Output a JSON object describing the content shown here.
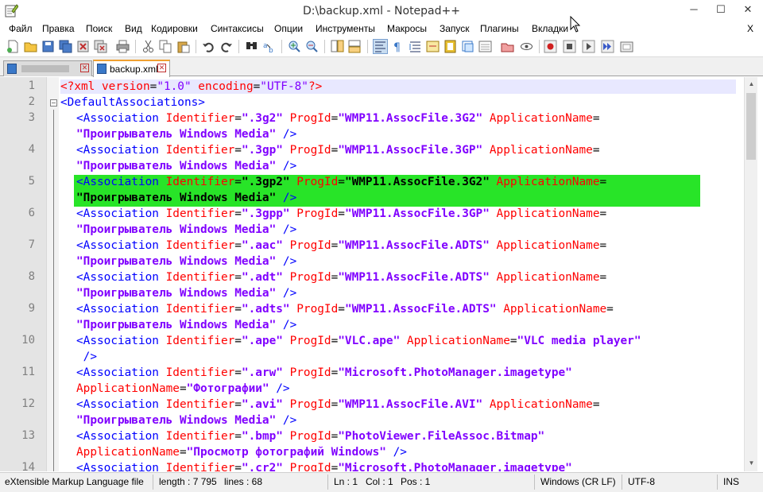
{
  "window": {
    "title": "D:\\backup.xml - Notepad++",
    "minimize": "─",
    "maximize": "☐",
    "close": "✕"
  },
  "menu": {
    "items": [
      "Файл",
      "Правка",
      "Поиск",
      "Вид",
      "Кодировки",
      "Синтаксисы",
      "Опции",
      "Инструменты",
      "Макросы",
      "Запуск",
      "Плагины",
      "Вкладки"
    ],
    "close": "X"
  },
  "toolbar": {
    "icons": [
      "new-file-icon",
      "open-file-icon",
      "save-icon",
      "save-all-icon",
      "close-icon",
      "close-all-icon",
      "print-icon",
      "cut-icon",
      "copy-icon",
      "paste-icon",
      "undo-icon",
      "redo-icon",
      "find-icon",
      "replace-icon",
      "zoom-in-icon",
      "zoom-out-icon",
      "sync-v-icon",
      "sync-h-icon",
      "word-wrap-icon",
      "show-all-chars-icon",
      "indent-guide-icon",
      "udl-icon",
      "doc-map-icon",
      "function-list-icon",
      "folder-workspace-icon",
      "monitoring-icon",
      "record-macro-icon",
      "stop-macro-icon",
      "play-macro-icon",
      "run-macro-multiple-icon",
      "save-macro-icon"
    ]
  },
  "tabs": [
    {
      "label": "",
      "active": false
    },
    {
      "label": "backup.xml",
      "active": true
    }
  ],
  "editor": {
    "line_numbers": [
      "1",
      "2",
      "3",
      "4",
      "5",
      "6",
      "7",
      "8",
      "9",
      "10",
      "11",
      "12",
      "13",
      "14"
    ],
    "lines": {
      "l1": {
        "pi_open": "<?",
        "name": "xml",
        "a1": " version",
        "eq": "=",
        "v1": "\"1.0\"",
        "a2": " encoding",
        "v2": "\"UTF-8\"",
        "pi_close": "?>"
      },
      "l2": {
        "tag": "<DefaultAssociations>"
      },
      "l3a": {
        "tag": "<Association",
        "a1": " Identifier",
        "v1": "\".3g2\"",
        "a2": " ProgId",
        "v2": "\"WMP11.AssocFile.3G2\"",
        "a3": " ApplicationName",
        "eq": "="
      },
      "l3b": {
        "v": "\"Проигрыватель Windows Media\"",
        "close": " />"
      },
      "l4a": {
        "tag": "<Association",
        "a1": " Identifier",
        "v1": "\".3gp\"",
        "a2": " ProgId",
        "v2": "\"WMP11.AssocFile.3GP\"",
        "a3": " ApplicationName",
        "eq": "="
      },
      "l4b": {
        "v": "\"Проигрыватель Windows Media\"",
        "close": " />"
      },
      "l5a": {
        "tag": "<Association",
        "a1": " Identifier",
        "v1": "\".3gp2\"",
        "a2": " ProgId",
        "v2": "\"WMP11.AssocFile.3G2\"",
        "a3": " ApplicationName",
        "eq": "="
      },
      "l5b": {
        "v": "\"Проигрыватель Windows Media\"",
        "close": " />"
      },
      "l6a": {
        "tag": "<Association",
        "a1": " Identifier",
        "v1": "\".3gpp\"",
        "a2": " ProgId",
        "v2": "\"WMP11.AssocFile.3GP\"",
        "a3": " ApplicationName",
        "eq": "="
      },
      "l6b": {
        "v": "\"Проигрыватель Windows Media\"",
        "close": " />"
      },
      "l7a": {
        "tag": "<Association",
        "a1": " Identifier",
        "v1": "\".aac\"",
        "a2": " ProgId",
        "v2": "\"WMP11.AssocFile.ADTS\"",
        "a3": " ApplicationName",
        "eq": "="
      },
      "l7b": {
        "v": "\"Проигрыватель Windows Media\"",
        "close": " />"
      },
      "l8a": {
        "tag": "<Association",
        "a1": " Identifier",
        "v1": "\".adt\"",
        "a2": " ProgId",
        "v2": "\"WMP11.AssocFile.ADTS\"",
        "a3": " ApplicationName",
        "eq": "="
      },
      "l8b": {
        "v": "\"Проигрыватель Windows Media\"",
        "close": " />"
      },
      "l9a": {
        "tag": "<Association",
        "a1": " Identifier",
        "v1": "\".adts\"",
        "a2": " ProgId",
        "v2": "\"WMP11.AssocFile.ADTS\"",
        "a3": " ApplicationName",
        "eq": "="
      },
      "l9b": {
        "v": "\"Проигрыватель Windows Media\"",
        "close": " />"
      },
      "l10a": {
        "tag": "<Association",
        "a1": " Identifier",
        "v1": "\".ape\"",
        "a2": " ProgId",
        "v2": "\"VLC.ape\"",
        "a3": " ApplicationName",
        "eq": "=",
        "v3": "\"VLC media player\""
      },
      "l10b": {
        "close": " />"
      },
      "l11a": {
        "tag": "<Association",
        "a1": " Identifier",
        "v1": "\".arw\"",
        "a2": " ProgId",
        "v2": "\"Microsoft.PhotoManager.imagetype\""
      },
      "l11b": {
        "a3": "ApplicationName",
        "eq": "=",
        "v3": "\"Фотографии\"",
        "close": " />"
      },
      "l12a": {
        "tag": "<Association",
        "a1": " Identifier",
        "v1": "\".avi\"",
        "a2": " ProgId",
        "v2": "\"WMP11.AssocFile.AVI\"",
        "a3": " ApplicationName",
        "eq": "="
      },
      "l12b": {
        "v": "\"Проигрыватель Windows Media\"",
        "close": " />"
      },
      "l13a": {
        "tag": "<Association",
        "a1": " Identifier",
        "v1": "\".bmp\"",
        "a2": " ProgId",
        "v2": "\"PhotoViewer.FileAssoc.Bitmap\""
      },
      "l13b": {
        "a3": "ApplicationName",
        "eq": "=",
        "v3": "\"Просмотр фотографий Windows\"",
        "close": " />"
      },
      "l14a": {
        "tag": "<Association",
        "a1": " Identifier",
        "v1": "\".cr2\"",
        "a2": " ProgId",
        "v2": "\"Microsoft.PhotoManager.imagetype\""
      }
    }
  },
  "status": {
    "file_type": "eXtensible Markup Language file",
    "length": "length : 7 795",
    "lines": "lines : 68",
    "ln": "Ln : 1",
    "col": "Col : 1",
    "pos": "Pos : 1",
    "eol": "Windows (CR LF)",
    "encoding": "UTF-8",
    "mode": "INS"
  },
  "colors": {
    "highlight": "#28e428",
    "tag": "#0000ff",
    "attribute": "#ff0000",
    "value": "#8000ff"
  }
}
